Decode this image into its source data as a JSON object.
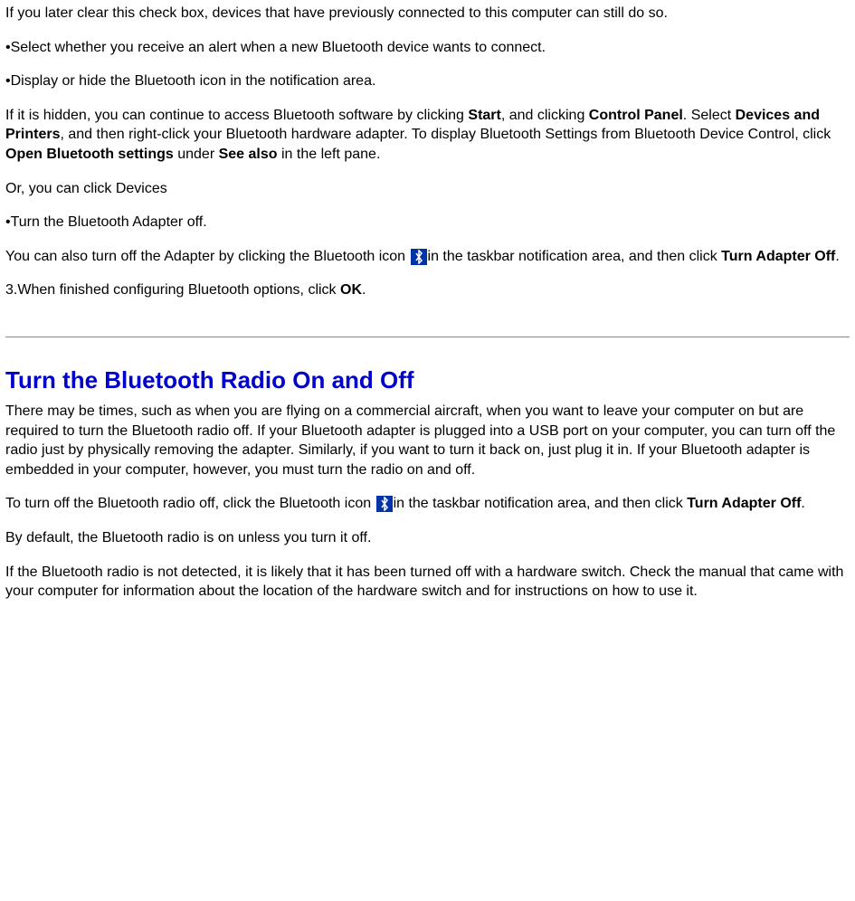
{
  "p1": "If you later clear this check box, devices that have previously connected to this computer can still do so.",
  "p2": "•Select whether you receive an alert when a new Bluetooth device wants to connect.",
  "p3": "•Display or hide the Bluetooth icon in the notification area.",
  "p4": {
    "t1": "If it is hidden, you can continue to access Bluetooth software by clicking ",
    "b1": "Start",
    "t2": ", and clicking ",
    "b2": "Control Panel",
    "t3": ". Select ",
    "b3": "Devices and Printers",
    "t4": ", and then right-click your Bluetooth hardware adapter. To display Bluetooth Settings from Bluetooth Device Control, click ",
    "b4": "Open Bluetooth settings",
    "t5": " under ",
    "b5": "See also",
    "t6": " in the left pane."
  },
  "p5": "Or, you can click Devices",
  "p6": "•Turn the Bluetooth Adapter off.",
  "p7": {
    "t1": "You can also turn off the Adapter by clicking the Bluetooth icon ",
    "t2": "in the taskbar notification area, and then click ",
    "b1": "Turn Adapter Off",
    "t3": "."
  },
  "p8": {
    "t1": "3.When finished configuring Bluetooth options, click ",
    "b1": "OK",
    "t2": "."
  },
  "heading": "Turn the Bluetooth Radio On and Off",
  "p9": "There may be times, such as when you are flying on a commercial aircraft, when you want to leave your computer on but are required to turn the Bluetooth radio off. If your Bluetooth adapter is plugged into a USB port on your computer, you can turn off the radio just by physically removing the adapter. Similarly, if you want to turn it back on, just plug it in. If your Bluetooth adapter is embedded in your computer, however, you must turn the radio on and off.",
  "p10": {
    "t1": "To turn off the Bluetooth radio off, click the Bluetooth icon ",
    "t2": "in the taskbar notification area, and then click ",
    "b1": "Turn Adapter Off",
    "t3": "."
  },
  "p11": "By default, the Bluetooth radio is on unless you turn it off.",
  "p12": "If the Bluetooth radio is not detected, it is likely that it has been turned off with a hardware switch. Check the manual that came with your computer for information about the location of the hardware switch and for instructions on how to use it."
}
